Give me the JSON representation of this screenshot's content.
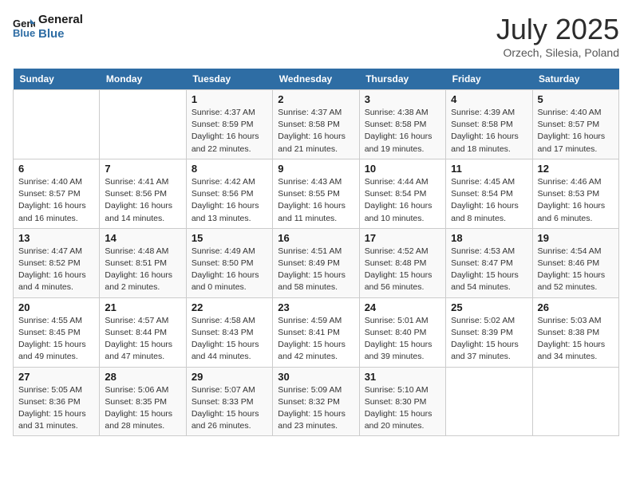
{
  "header": {
    "logo_text_general": "General",
    "logo_text_blue": "Blue",
    "month_year": "July 2025",
    "location": "Orzech, Silesia, Poland"
  },
  "weekdays": [
    "Sunday",
    "Monday",
    "Tuesday",
    "Wednesday",
    "Thursday",
    "Friday",
    "Saturday"
  ],
  "weeks": [
    [
      {
        "day": "",
        "info": ""
      },
      {
        "day": "",
        "info": ""
      },
      {
        "day": "1",
        "info": "Sunrise: 4:37 AM\nSunset: 8:59 PM\nDaylight: 16 hours\nand 22 minutes."
      },
      {
        "day": "2",
        "info": "Sunrise: 4:37 AM\nSunset: 8:58 PM\nDaylight: 16 hours\nand 21 minutes."
      },
      {
        "day": "3",
        "info": "Sunrise: 4:38 AM\nSunset: 8:58 PM\nDaylight: 16 hours\nand 19 minutes."
      },
      {
        "day": "4",
        "info": "Sunrise: 4:39 AM\nSunset: 8:58 PM\nDaylight: 16 hours\nand 18 minutes."
      },
      {
        "day": "5",
        "info": "Sunrise: 4:40 AM\nSunset: 8:57 PM\nDaylight: 16 hours\nand 17 minutes."
      }
    ],
    [
      {
        "day": "6",
        "info": "Sunrise: 4:40 AM\nSunset: 8:57 PM\nDaylight: 16 hours\nand 16 minutes."
      },
      {
        "day": "7",
        "info": "Sunrise: 4:41 AM\nSunset: 8:56 PM\nDaylight: 16 hours\nand 14 minutes."
      },
      {
        "day": "8",
        "info": "Sunrise: 4:42 AM\nSunset: 8:56 PM\nDaylight: 16 hours\nand 13 minutes."
      },
      {
        "day": "9",
        "info": "Sunrise: 4:43 AM\nSunset: 8:55 PM\nDaylight: 16 hours\nand 11 minutes."
      },
      {
        "day": "10",
        "info": "Sunrise: 4:44 AM\nSunset: 8:54 PM\nDaylight: 16 hours\nand 10 minutes."
      },
      {
        "day": "11",
        "info": "Sunrise: 4:45 AM\nSunset: 8:54 PM\nDaylight: 16 hours\nand 8 minutes."
      },
      {
        "day": "12",
        "info": "Sunrise: 4:46 AM\nSunset: 8:53 PM\nDaylight: 16 hours\nand 6 minutes."
      }
    ],
    [
      {
        "day": "13",
        "info": "Sunrise: 4:47 AM\nSunset: 8:52 PM\nDaylight: 16 hours\nand 4 minutes."
      },
      {
        "day": "14",
        "info": "Sunrise: 4:48 AM\nSunset: 8:51 PM\nDaylight: 16 hours\nand 2 minutes."
      },
      {
        "day": "15",
        "info": "Sunrise: 4:49 AM\nSunset: 8:50 PM\nDaylight: 16 hours\nand 0 minutes."
      },
      {
        "day": "16",
        "info": "Sunrise: 4:51 AM\nSunset: 8:49 PM\nDaylight: 15 hours\nand 58 minutes."
      },
      {
        "day": "17",
        "info": "Sunrise: 4:52 AM\nSunset: 8:48 PM\nDaylight: 15 hours\nand 56 minutes."
      },
      {
        "day": "18",
        "info": "Sunrise: 4:53 AM\nSunset: 8:47 PM\nDaylight: 15 hours\nand 54 minutes."
      },
      {
        "day": "19",
        "info": "Sunrise: 4:54 AM\nSunset: 8:46 PM\nDaylight: 15 hours\nand 52 minutes."
      }
    ],
    [
      {
        "day": "20",
        "info": "Sunrise: 4:55 AM\nSunset: 8:45 PM\nDaylight: 15 hours\nand 49 minutes."
      },
      {
        "day": "21",
        "info": "Sunrise: 4:57 AM\nSunset: 8:44 PM\nDaylight: 15 hours\nand 47 minutes."
      },
      {
        "day": "22",
        "info": "Sunrise: 4:58 AM\nSunset: 8:43 PM\nDaylight: 15 hours\nand 44 minutes."
      },
      {
        "day": "23",
        "info": "Sunrise: 4:59 AM\nSunset: 8:41 PM\nDaylight: 15 hours\nand 42 minutes."
      },
      {
        "day": "24",
        "info": "Sunrise: 5:01 AM\nSunset: 8:40 PM\nDaylight: 15 hours\nand 39 minutes."
      },
      {
        "day": "25",
        "info": "Sunrise: 5:02 AM\nSunset: 8:39 PM\nDaylight: 15 hours\nand 37 minutes."
      },
      {
        "day": "26",
        "info": "Sunrise: 5:03 AM\nSunset: 8:38 PM\nDaylight: 15 hours\nand 34 minutes."
      }
    ],
    [
      {
        "day": "27",
        "info": "Sunrise: 5:05 AM\nSunset: 8:36 PM\nDaylight: 15 hours\nand 31 minutes."
      },
      {
        "day": "28",
        "info": "Sunrise: 5:06 AM\nSunset: 8:35 PM\nDaylight: 15 hours\nand 28 minutes."
      },
      {
        "day": "29",
        "info": "Sunrise: 5:07 AM\nSunset: 8:33 PM\nDaylight: 15 hours\nand 26 minutes."
      },
      {
        "day": "30",
        "info": "Sunrise: 5:09 AM\nSunset: 8:32 PM\nDaylight: 15 hours\nand 23 minutes."
      },
      {
        "day": "31",
        "info": "Sunrise: 5:10 AM\nSunset: 8:30 PM\nDaylight: 15 hours\nand 20 minutes."
      },
      {
        "day": "",
        "info": ""
      },
      {
        "day": "",
        "info": ""
      }
    ]
  ]
}
